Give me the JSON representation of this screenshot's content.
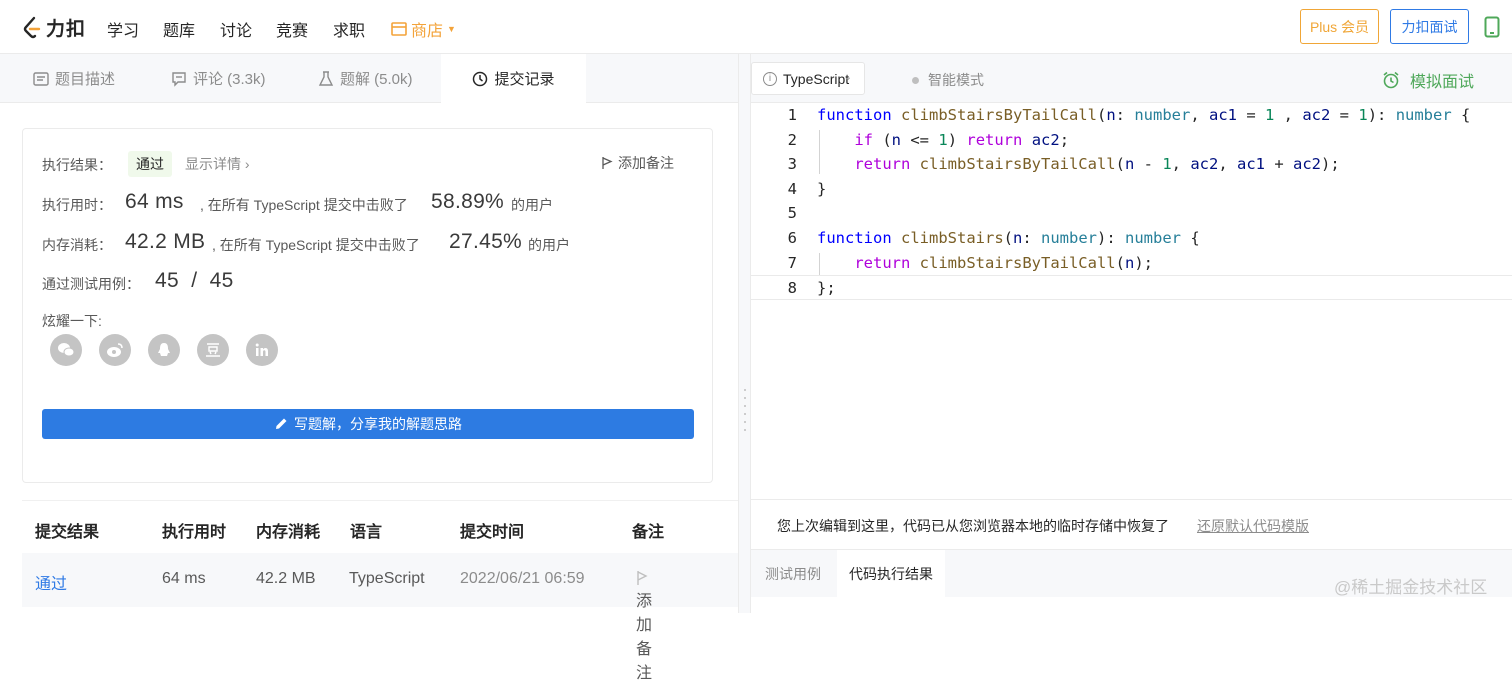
{
  "nav": {
    "logo_text": "力扣",
    "items": [
      "学习",
      "题库",
      "讨论",
      "竞赛",
      "求职"
    ],
    "store_label": "商店",
    "plus_label": "Plus 会员",
    "interview_label": "力扣面试"
  },
  "left_tabs": {
    "description": "题目描述",
    "comments": "评论 (3.3k)",
    "solutions": "题解 (5.0k)",
    "submissions": "提交记录"
  },
  "result": {
    "result_label": "执行结果：",
    "status": "通过",
    "detail_link": "显示详情 ›",
    "add_note": "添加备注",
    "runtime_label": "执行用时：",
    "runtime_value": "64 ms",
    "runtime_text": ", 在所有 TypeScript 提交中击败了",
    "runtime_pct": "58.89%",
    "users_suffix": "的用户",
    "memory_label": "内存消耗：",
    "memory_value": "42.2 MB",
    "memory_text": ", 在所有 TypeScript 提交中击败了",
    "memory_pct": "27.45%",
    "cases_label": "通过测试用例：",
    "cases_value": "45  /  45",
    "share_label": "炫耀一下:",
    "share_icons": [
      "wechat-icon",
      "weibo-icon",
      "qq-icon",
      "douban-icon",
      "linkedin-icon"
    ],
    "write_button": "写题解，分享我的解题思路"
  },
  "submissions": {
    "headers": [
      "提交结果",
      "执行用时",
      "内存消耗",
      "语言",
      "提交时间",
      "备注"
    ],
    "rows": [
      {
        "result": "通过",
        "runtime": "64 ms",
        "memory": "42.2 MB",
        "lang": "TypeScript",
        "time": "2022/06/21 06:59",
        "note": "添加备注"
      }
    ]
  },
  "editor_bar": {
    "language": "TypeScript",
    "smart_mode": "智能模式",
    "mock_interview": "模拟面试"
  },
  "code_lines": [
    "function climbStairsByTailCall(n: number, ac1 = 1 , ac2 = 1): number {",
    "    if (n <= 1) return ac2;",
    "    return climbStairsByTailCall(n - 1, ac2, ac1 + ac2);",
    "}",
    "",
    "function climbStairs(n: number): number {",
    "    return climbStairsByTailCall(n);",
    "};"
  ],
  "restore": {
    "message": "您上次编辑到这里，代码已从您浏览器本地的临时存储中恢复了",
    "link": "还原默认代码模版"
  },
  "bottom_tabs": {
    "testcases": "测试用例",
    "run_result": "代码执行结果"
  },
  "watermark": "@稀土掘金技术社区",
  "colors": {
    "accent_blue": "#2d7be2",
    "store_orange": "#f3a33a",
    "mock_green": "#4fa85a",
    "link_blue": "#2f7ae5"
  }
}
